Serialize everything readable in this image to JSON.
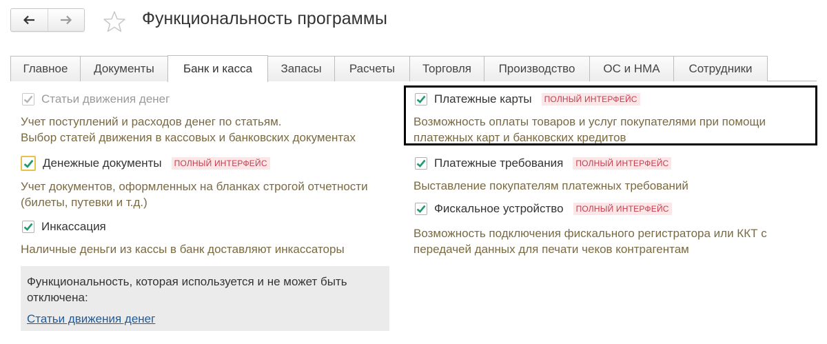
{
  "window": {
    "title": "Функциональность программы"
  },
  "nav": {
    "back_icon": "arrow-left-icon",
    "forward_icon": "arrow-right-icon",
    "favorite_icon": "star-outline-icon"
  },
  "tabs": [
    {
      "label": "Главное",
      "active": false
    },
    {
      "label": "Документы",
      "active": false
    },
    {
      "label": "Банк и касса",
      "active": true
    },
    {
      "label": "Запасы",
      "active": false
    },
    {
      "label": "Расчеты",
      "active": false
    },
    {
      "label": "Торговля",
      "active": false
    },
    {
      "label": "Производство",
      "active": false
    },
    {
      "label": "ОС и НМА",
      "active": false
    },
    {
      "label": "Сотрудники",
      "active": false
    }
  ],
  "left": {
    "cashflow": {
      "label": "Статьи движения денег",
      "checked": true,
      "disabled": true,
      "desc1": "Учет поступлений и расходов денег по статьям.",
      "desc2": "Выбор статей движения в кассовых и банковских документах"
    },
    "money_docs": {
      "label": "Денежные документы",
      "checked": true,
      "badge": "ПОЛНЫЙ ИНТЕРФЕЙС",
      "desc1": "Учет документов, оформленных на бланках строгой отчетности",
      "desc2": "(билеты, путевки и т.д.)"
    },
    "collection": {
      "label": "Инкассация",
      "checked": true,
      "desc1": "Наличные деньги из кассы в банк доставляют инкассаторы"
    },
    "info": {
      "text1": "Функциональность, которая используется и не может быть",
      "text2": "отключена:",
      "link": "Статьи движения денег"
    }
  },
  "right": {
    "payment_cards": {
      "label": "Платежные карты",
      "checked": true,
      "badge": "ПОЛНЫЙ ИНТЕРФЕЙС",
      "desc1": "Возможность оплаты товаров и услуг покупателями при помощи",
      "desc2": "платежных карт и банковских кредитов"
    },
    "payment_requests": {
      "label": "Платежные требования",
      "checked": true,
      "badge": "ПОЛНЫЙ ИНТЕРФЕЙС",
      "desc1": "Выставление покупателям платежных требований"
    },
    "fiscal_device": {
      "label": "Фискальное устройство",
      "checked": true,
      "badge": "ПОЛНЫЙ ИНТЕРФЕЙС",
      "desc1": "Возможность подключения фискального регистратора или ККТ с",
      "desc2": "передачей данных для печати чеков контрагентам"
    }
  },
  "colors": {
    "check": "#1e9b6e",
    "badge_text": "#c63c4c",
    "badge_bg": "#fbe6e8",
    "desc": "#7a6a42",
    "link": "#1d5a9c",
    "focus": "#e8c04a"
  }
}
